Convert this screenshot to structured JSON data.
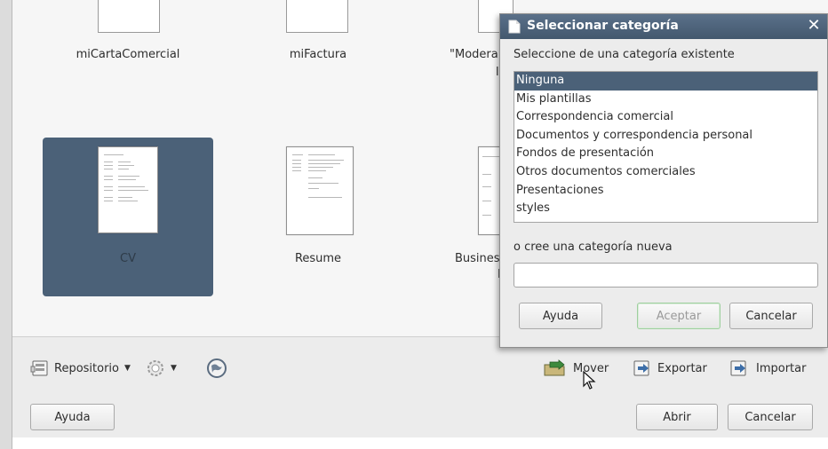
{
  "templates": [
    {
      "name": "miCartaComercial",
      "selected": false
    },
    {
      "name": "miFactura",
      "selected": false
    },
    {
      "name": "\"Modera",
      "selected": false
    },
    {
      "name": "CV",
      "selected": true
    },
    {
      "name": "Resume",
      "selected": false
    },
    {
      "name": "Busines",
      "selected": false
    }
  ],
  "partial_labels": {
    "moderate_line2": "le",
    "business_line2": "I"
  },
  "toolbar": {
    "repository": "Repositorio",
    "move": "Mover",
    "export": "Exportar",
    "import": "Importar"
  },
  "footer": {
    "help": "Ayuda",
    "open": "Abrir",
    "cancel": "Cancelar"
  },
  "dialog": {
    "title": "Seleccionar categoría",
    "existing_label": "Seleccione de una categoría existente",
    "categories": [
      "Ninguna",
      "Mis plantillas",
      "Correspondencia comercial",
      "Documentos y correspondencia personal",
      "Fondos de presentación",
      "Otros documentos comerciales",
      "Presentaciones",
      "styles"
    ],
    "selected_index": 0,
    "new_label": "o cree una categoría nueva",
    "new_value": "",
    "help": "Ayuda",
    "accept": "Aceptar",
    "cancel": "Cancelar"
  },
  "colors": {
    "selection": "#4b6178",
    "titlebar": "#4e647b"
  }
}
